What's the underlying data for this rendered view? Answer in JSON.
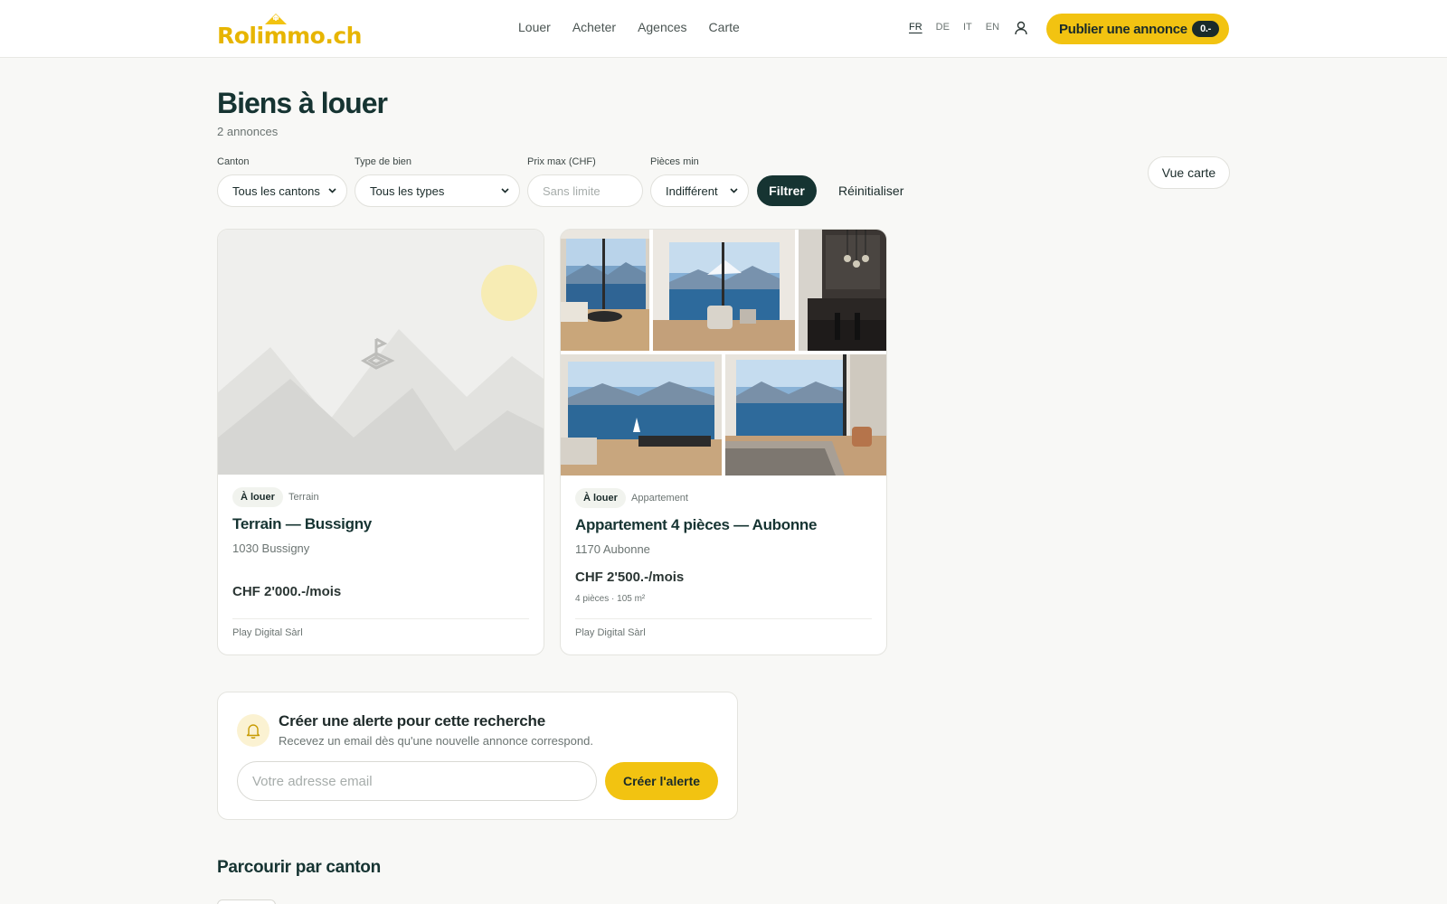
{
  "header": {
    "logo_text": "Rolimmo.ch",
    "nav": [
      "Louer",
      "Acheter",
      "Agences",
      "Carte"
    ],
    "languages": [
      "FR",
      "DE",
      "IT",
      "EN"
    ],
    "active_language": "FR",
    "publish_label": "Publier une annonce",
    "publish_price": "0.-"
  },
  "page": {
    "title": "Biens à louer",
    "count": "2 annonces"
  },
  "filters": {
    "canton_label": "Canton",
    "canton_value": "Tous les cantons",
    "type_label": "Type de bien",
    "type_value": "Tous les types",
    "price_label": "Prix max (CHF)",
    "price_placeholder": "Sans limite",
    "rooms_label": "Pièces min",
    "rooms_value": "Indifférent",
    "filter_button": "Filtrer",
    "reset_button": "Réinitialiser",
    "map_button": "Vue carte"
  },
  "listings": [
    {
      "status": "À louer",
      "type": "Terrain",
      "title": "Terrain — Bussigny",
      "address": "1030 Bussigny",
      "price": "CHF 2'000.-/mois",
      "meta": "",
      "agency": "Play Digital Sàrl"
    },
    {
      "status": "À louer",
      "type": "Appartement",
      "title": "Appartement 4 pièces — Aubonne",
      "address": "1170 Aubonne",
      "price": "CHF 2'500.-/mois",
      "meta": "4 pièces · 105 m²",
      "agency": "Play Digital Sàrl"
    }
  ],
  "alert": {
    "title": "Créer une alerte pour cette recherche",
    "subtitle": "Recevez un email dès qu'une nouvelle annonce correspond.",
    "email_placeholder": "Votre adresse email",
    "button": "Créer l'alerte"
  },
  "browse": {
    "title": "Parcourir par canton"
  },
  "icons": {
    "user": "user-icon",
    "bell": "bell-icon",
    "chevron": "chevron-down-icon",
    "placeholder": "pin-icon"
  },
  "colors": {
    "brand_yellow": "#f2c311",
    "brand_dark": "#163432",
    "background": "#f8f8f6"
  }
}
